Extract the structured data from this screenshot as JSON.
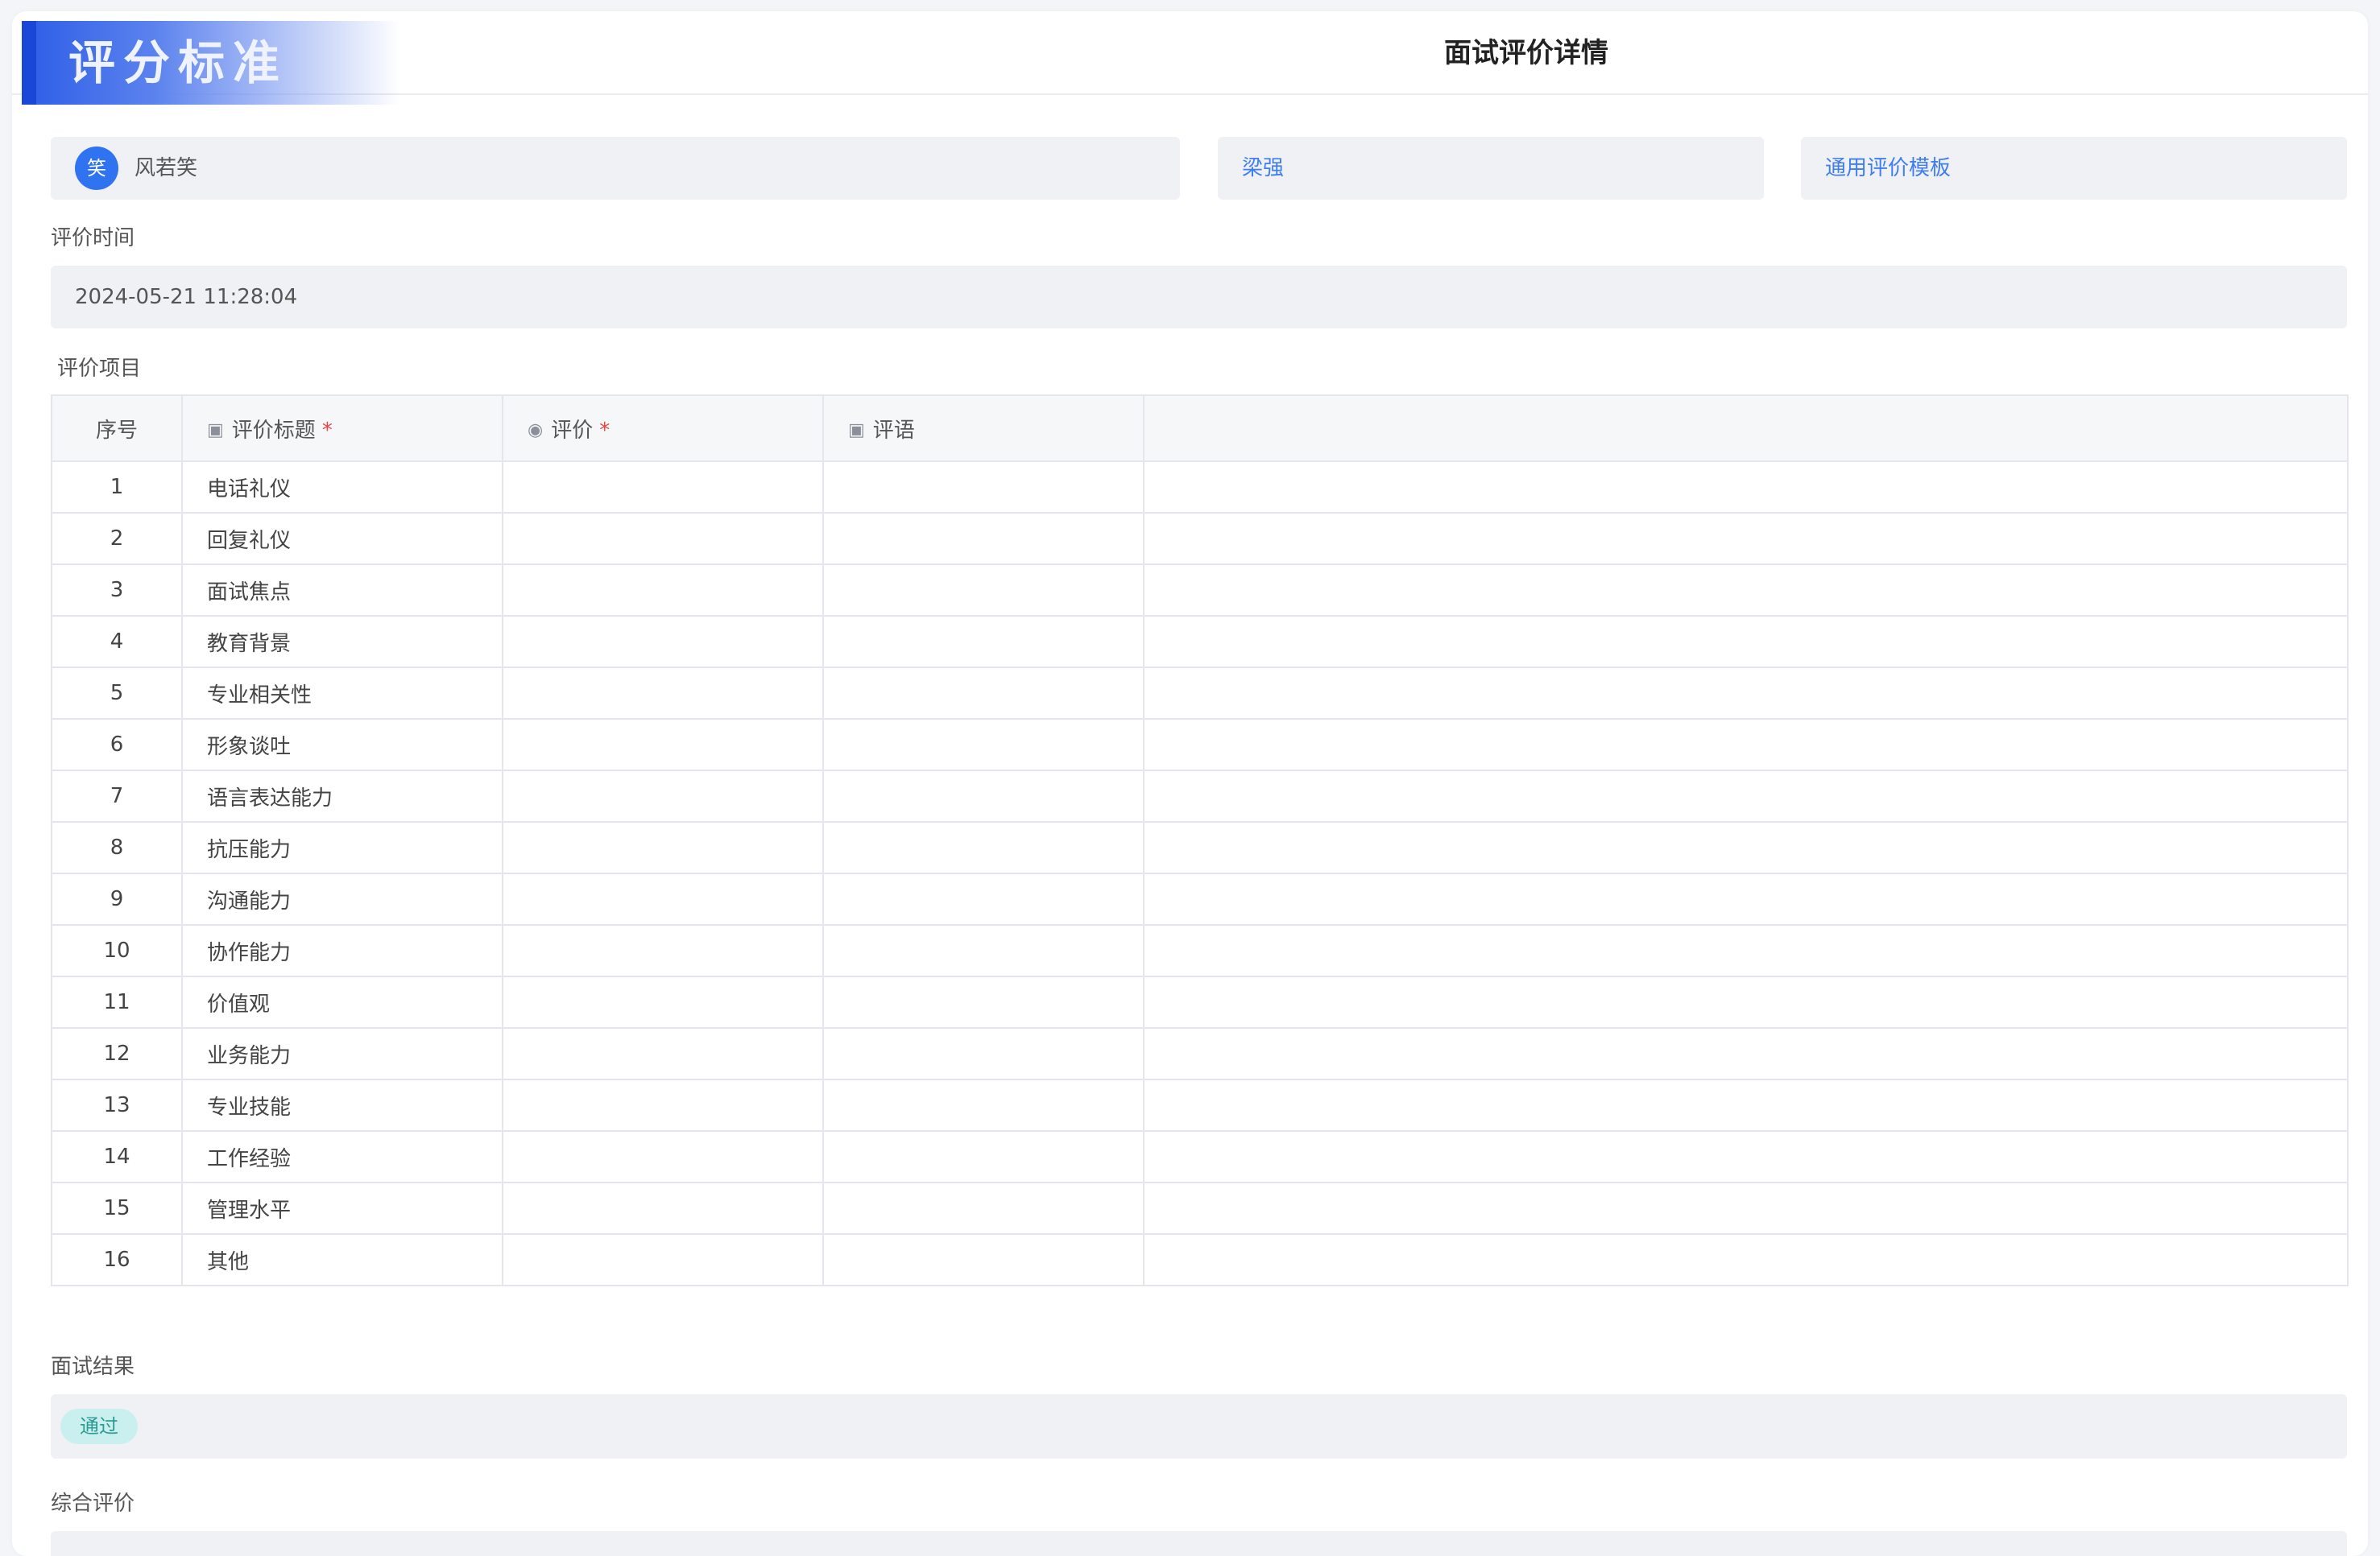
{
  "header": {
    "brand_label": "评分标准",
    "title": "面试评价详情"
  },
  "interviewer": {
    "avatar_char": "笑",
    "name": "风若笑"
  },
  "candidate": {
    "name": "梁强"
  },
  "template": {
    "name": "通用评价模板"
  },
  "eval_time": {
    "label": "评价时间",
    "value": "2024-05-21 11:28:04"
  },
  "eval_items": {
    "label": "评价项目",
    "columns": {
      "index": "序号",
      "title": "评价标题",
      "rating": "评价",
      "comment": "评语"
    },
    "rows": [
      {
        "index": "1",
        "title": "电话礼仪"
      },
      {
        "index": "2",
        "title": "回复礼仪"
      },
      {
        "index": "3",
        "title": "面试焦点"
      },
      {
        "index": "4",
        "title": "教育背景"
      },
      {
        "index": "5",
        "title": "专业相关性"
      },
      {
        "index": "6",
        "title": "形象谈吐"
      },
      {
        "index": "7",
        "title": "语言表达能力"
      },
      {
        "index": "8",
        "title": "抗压能力"
      },
      {
        "index": "9",
        "title": "沟通能力"
      },
      {
        "index": "10",
        "title": "协作能力"
      },
      {
        "index": "11",
        "title": "价值观"
      },
      {
        "index": "12",
        "title": "业务能力"
      },
      {
        "index": "13",
        "title": "专业技能"
      },
      {
        "index": "14",
        "title": "工作经验"
      },
      {
        "index": "15",
        "title": "管理水平"
      },
      {
        "index": "16",
        "title": "其他"
      }
    ]
  },
  "result": {
    "label": "面试结果",
    "value": "通过"
  },
  "overall": {
    "label": "综合评价"
  },
  "colors": {
    "accent": "#2f73f0",
    "link": "#3f7ef2",
    "required": "#e84545",
    "pass_tag_bg": "#c9f0ee",
    "pass_tag_text": "#2a9a93"
  }
}
